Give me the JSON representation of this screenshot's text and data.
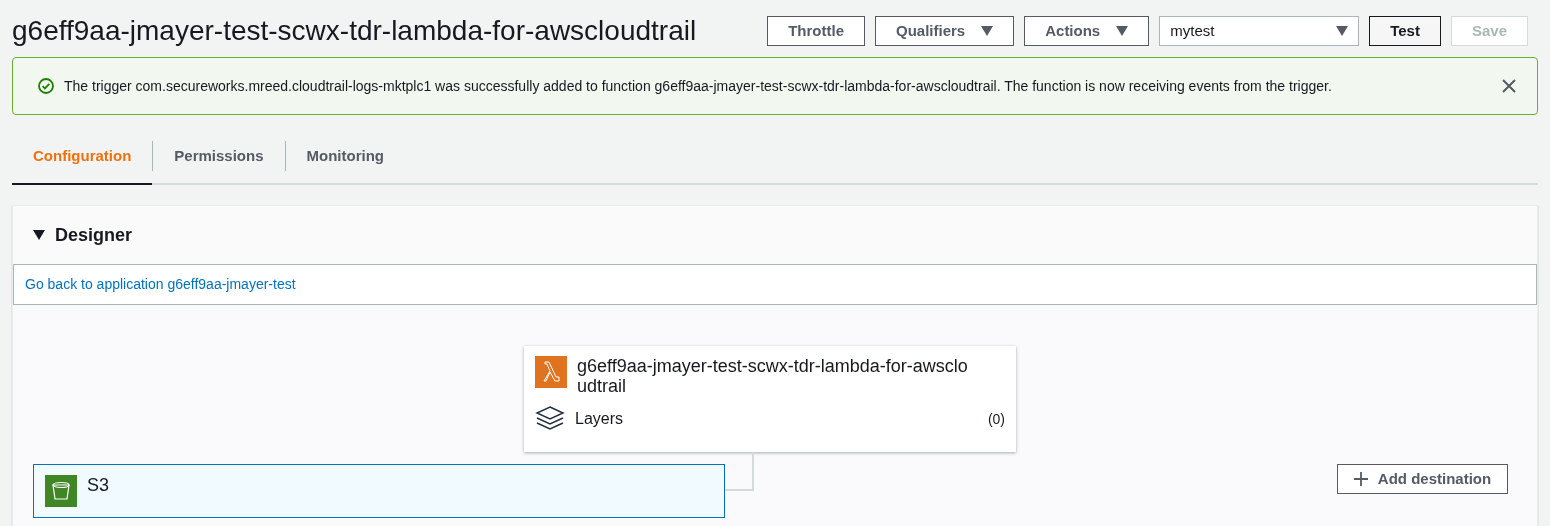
{
  "title": "g6eff9aa-jmayer-test-scwx-tdr-lambda-for-awscloudtrail",
  "header_buttons": [
    {
      "kind": "button",
      "label": "Throttle",
      "disabled": false,
      "primary": false
    },
    {
      "kind": "dropdown",
      "label": "Qualifiers",
      "disabled": false,
      "primary": false
    },
    {
      "kind": "dropdown",
      "label": "Actions",
      "disabled": false,
      "primary": false
    },
    {
      "kind": "select",
      "label": "mytest"
    },
    {
      "kind": "button",
      "label": "Test",
      "disabled": false,
      "primary": true
    },
    {
      "kind": "button",
      "label": "Save",
      "disabled": true,
      "primary": false
    }
  ],
  "banner": {
    "message": "The trigger com.secureworks.mreed.cloudtrail-logs-mktplc1 was successfully added to function g6eff9aa-jmayer-test-scwx-tdr-lambda-for-awscloudtrail. The function is now receiving events from the trigger."
  },
  "tabs": [
    {
      "label": "Configuration",
      "selected": true
    },
    {
      "label": "Permissions",
      "selected": false
    },
    {
      "label": "Monitoring",
      "selected": false
    }
  ],
  "designer": {
    "title": "Designer",
    "expanded": true,
    "link": "Go back to application g6eff9aa-jmayer-test",
    "function": {
      "name": "g6eff9aa-jmayer-test-scwx-tdr-lambda-for-awscloudtrail",
      "layers_label": "Layers",
      "layers_count": "(0)"
    },
    "trigger": {
      "name": "S3"
    },
    "add_destination": "Add destination"
  }
}
